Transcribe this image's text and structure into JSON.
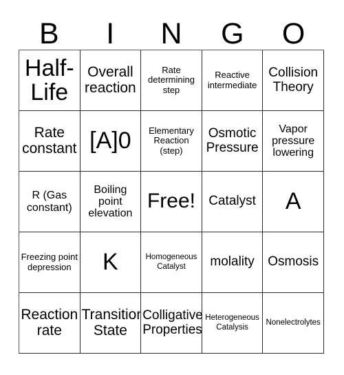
{
  "header": {
    "letters": [
      {
        "label": "B"
      },
      {
        "label": "I"
      },
      {
        "label": "N"
      },
      {
        "label": "G"
      },
      {
        "label": "O"
      }
    ]
  },
  "grid": {
    "columns": 5,
    "rows": 5,
    "free_space_label": "Free!",
    "cells": [
      {
        "text": "Half-Life",
        "size": "fs-xxl"
      },
      {
        "text": "Overall reaction",
        "size": "fs-lg"
      },
      {
        "text": "Rate determining step",
        "size": "fs-xs"
      },
      {
        "text": "Reactive intermediate",
        "size": "fs-xs"
      },
      {
        "text": "Collision Theory",
        "size": "fs-md"
      },
      {
        "text": "Rate constant",
        "size": "fs-lg"
      },
      {
        "text": "[A]0",
        "size": "fs-xxl"
      },
      {
        "text": "Elementary Reaction (step)",
        "size": "fs-xs"
      },
      {
        "text": "Osmotic Pressure",
        "size": "fs-md"
      },
      {
        "text": "Vapor pressure lowering",
        "size": "fs-sm"
      },
      {
        "text": "R (Gas constant)",
        "size": "fs-sm"
      },
      {
        "text": "Boiling point elevation",
        "size": "fs-sm"
      },
      {
        "text": "Free!",
        "size": "fs-xl"
      },
      {
        "text": "Catalyst",
        "size": "fs-md"
      },
      {
        "text": "A",
        "size": "fs-xxl"
      },
      {
        "text": "Freezing point depression",
        "size": "fs-xs"
      },
      {
        "text": "K",
        "size": "fs-xxl"
      },
      {
        "text": "Homogeneous Catalyst",
        "size": "fs-xxs"
      },
      {
        "text": "molality",
        "size": "fs-md"
      },
      {
        "text": "Osmosis",
        "size": "fs-md"
      },
      {
        "text": "Reaction rate",
        "size": "fs-lg"
      },
      {
        "text": "Transition State",
        "size": "fs-lg"
      },
      {
        "text": "Colligative Properties",
        "size": "fs-md"
      },
      {
        "text": "Heterogeneous Catalysis",
        "size": "fs-xxs"
      },
      {
        "text": "Nonelectrolytes",
        "size": "fs-xxs"
      }
    ]
  }
}
